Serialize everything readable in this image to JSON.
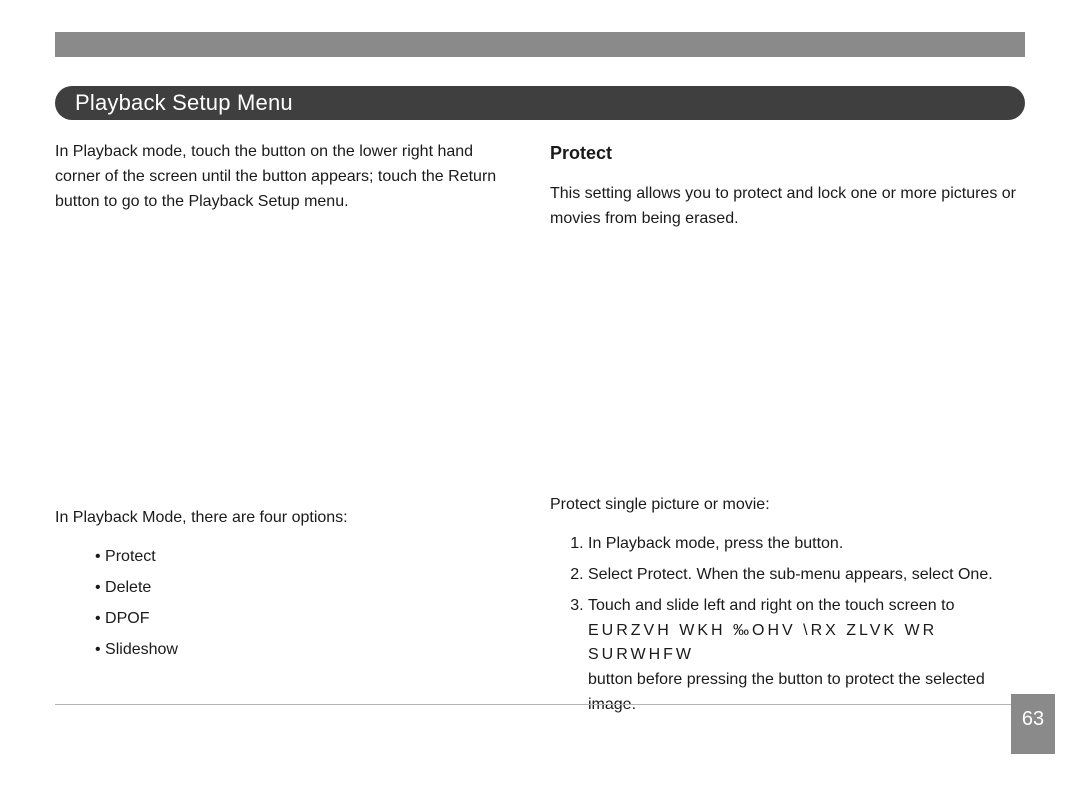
{
  "section_title": "Playback Setup Menu",
  "left": {
    "intro": "In Playback mode, touch the            button on the lower right hand corner of the screen until the            button appears; touch the Return button to go to the Playback Setup menu.",
    "subintro": "In Playback Mode, there are four options:",
    "options": [
      "Protect",
      "Delete",
      "DPOF",
      "Slideshow"
    ]
  },
  "right": {
    "heading": "Protect",
    "desc": "This setting allows you to protect and lock one or more pictures or movies from being erased.",
    "steps_label": "Protect single picture or movie:",
    "steps": {
      "s1": "In Playback mode, press the            button.",
      "s2": "Select Protect. When the sub-menu appears, select One.",
      "s3a": "Touch and slide left and right on the touch screen to",
      "s3b": "EURZVH  WKH  ‰OHV  \\RX  ZLVK  WR  SURWHFW",
      "s3c": "button before pressing the            button to protect the selected image."
    }
  },
  "page_number": "63"
}
